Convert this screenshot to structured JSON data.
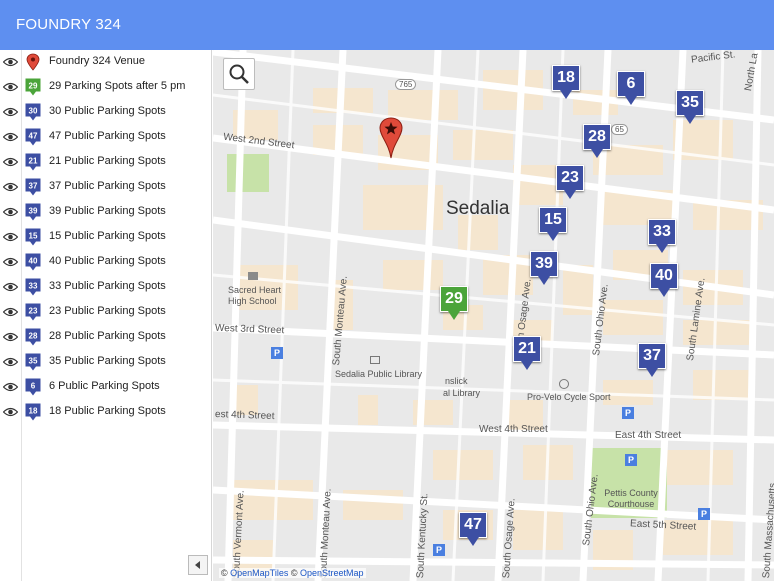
{
  "header": {
    "title": "FOUNDRY 324"
  },
  "layers": [
    {
      "label": "Foundry 324 Venue",
      "badge": "",
      "kind": "venue"
    },
    {
      "label": "29 Parking Spots after 5 pm",
      "badge": "29",
      "kind": "green"
    },
    {
      "label": "30 Public Parking Spots",
      "badge": "30",
      "kind": "blue"
    },
    {
      "label": "47 Public Parking Spots",
      "badge": "47",
      "kind": "blue"
    },
    {
      "label": "21 Public Parking Spots",
      "badge": "21",
      "kind": "blue"
    },
    {
      "label": "37 Public Parking Spots",
      "badge": "37",
      "kind": "blue"
    },
    {
      "label": "39 Public Parking Spots",
      "badge": "39",
      "kind": "blue"
    },
    {
      "label": "15 Public Parking Spots",
      "badge": "15",
      "kind": "blue"
    },
    {
      "label": "40 Public Parking Spots",
      "badge": "40",
      "kind": "blue"
    },
    {
      "label": "33 Public Parking Spots",
      "badge": "33",
      "kind": "blue"
    },
    {
      "label": "23 Public Parking Spots",
      "badge": "23",
      "kind": "blue"
    },
    {
      "label": "28 Public Parking Spots",
      "badge": "28",
      "kind": "blue"
    },
    {
      "label": "35 Public Parking Spots",
      "badge": "35",
      "kind": "blue"
    },
    {
      "label": "6 Public Parking Spots",
      "badge": "6",
      "kind": "blue"
    },
    {
      "label": "18 Public Parking Spots",
      "badge": "18",
      "kind": "blue"
    }
  ],
  "map": {
    "city_label": "Sedalia",
    "streets": {
      "w2nd": "West 2nd Street",
      "w3rd": "West 3rd Street",
      "w4th": "West 4th Street",
      "w4th_left": "est 4th Street",
      "e4th": "East 4th Street",
      "e5th": "East 5th Street",
      "pacific": "Pacific St.",
      "north_la": "North La",
      "s_monteau": "South Monteau Ave.",
      "s_vermont": "South Vermont Ave.",
      "s_monteau2": "South Monteau Ave.",
      "s_kentucky": "South Kentucky St.",
      "s_osage": "South Osage Ave.",
      "s_osage2": "South Osage Ave.",
      "s_ohio": "South Ohio Ave.",
      "s_ohio2": "South Ohio Ave.",
      "s_lamine": "South Lamine Ave.",
      "s_mass": "South Massachusetts"
    },
    "route_765": "765",
    "route_65": "65",
    "pois": {
      "sacred_heart": "Sacred Heart High School",
      "library": "Sedalia Public Library",
      "library_partial": "nslick",
      "library_partial2": "al Library",
      "cycle": "Pro-Velo Cycle Sport",
      "courthouse": "Pettis County Courthouse"
    },
    "markers": [
      {
        "label": "18",
        "kind": "blue"
      },
      {
        "label": "6",
        "kind": "blue"
      },
      {
        "label": "35",
        "kind": "blue"
      },
      {
        "label": "28",
        "kind": "blue"
      },
      {
        "label": "23",
        "kind": "blue"
      },
      {
        "label": "15",
        "kind": "blue"
      },
      {
        "label": "33",
        "kind": "blue"
      },
      {
        "label": "39",
        "kind": "blue"
      },
      {
        "label": "40",
        "kind": "blue"
      },
      {
        "label": "29",
        "kind": "green"
      },
      {
        "label": "21",
        "kind": "blue"
      },
      {
        "label": "37",
        "kind": "blue"
      },
      {
        "label": "47",
        "kind": "blue"
      }
    ],
    "parking_sign": "P",
    "attribution": {
      "prefix": "©",
      "tiles": "OpenMapTiles",
      "sep": "©",
      "osm": "OpenStreetMap"
    }
  },
  "colors": {
    "header": "#5e8ff0",
    "marker_blue": "#3d4fa3",
    "marker_green": "#4ba43a",
    "venue_pin": "#e04a3a"
  }
}
